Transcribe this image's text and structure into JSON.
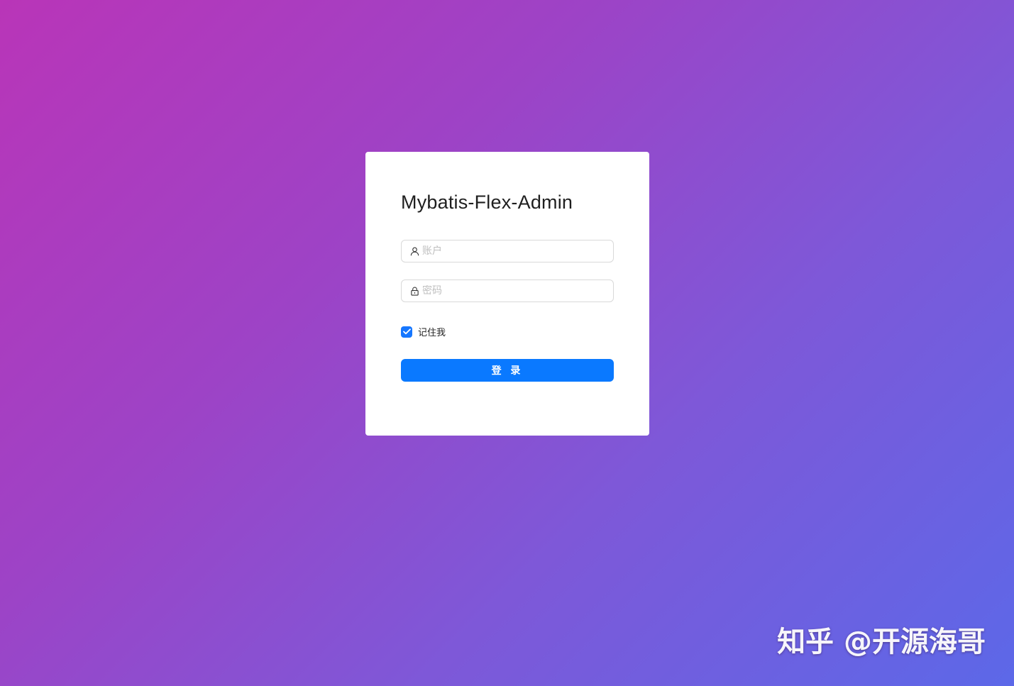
{
  "login": {
    "title": "Mybatis-Flex-Admin",
    "account": {
      "placeholder": "账户",
      "value": "",
      "icon": "user-icon"
    },
    "password": {
      "placeholder": "密码",
      "value": "",
      "icon": "lock-icon"
    },
    "remember": {
      "label": "记住我",
      "checked": true
    },
    "submit_label": "登 录"
  },
  "watermark": "知乎 @开源海哥",
  "colors": {
    "accent": "#0a79ff",
    "checkbox": "#1677ff",
    "gradient_start": "#b935b8",
    "gradient_end": "#5c68e8"
  }
}
